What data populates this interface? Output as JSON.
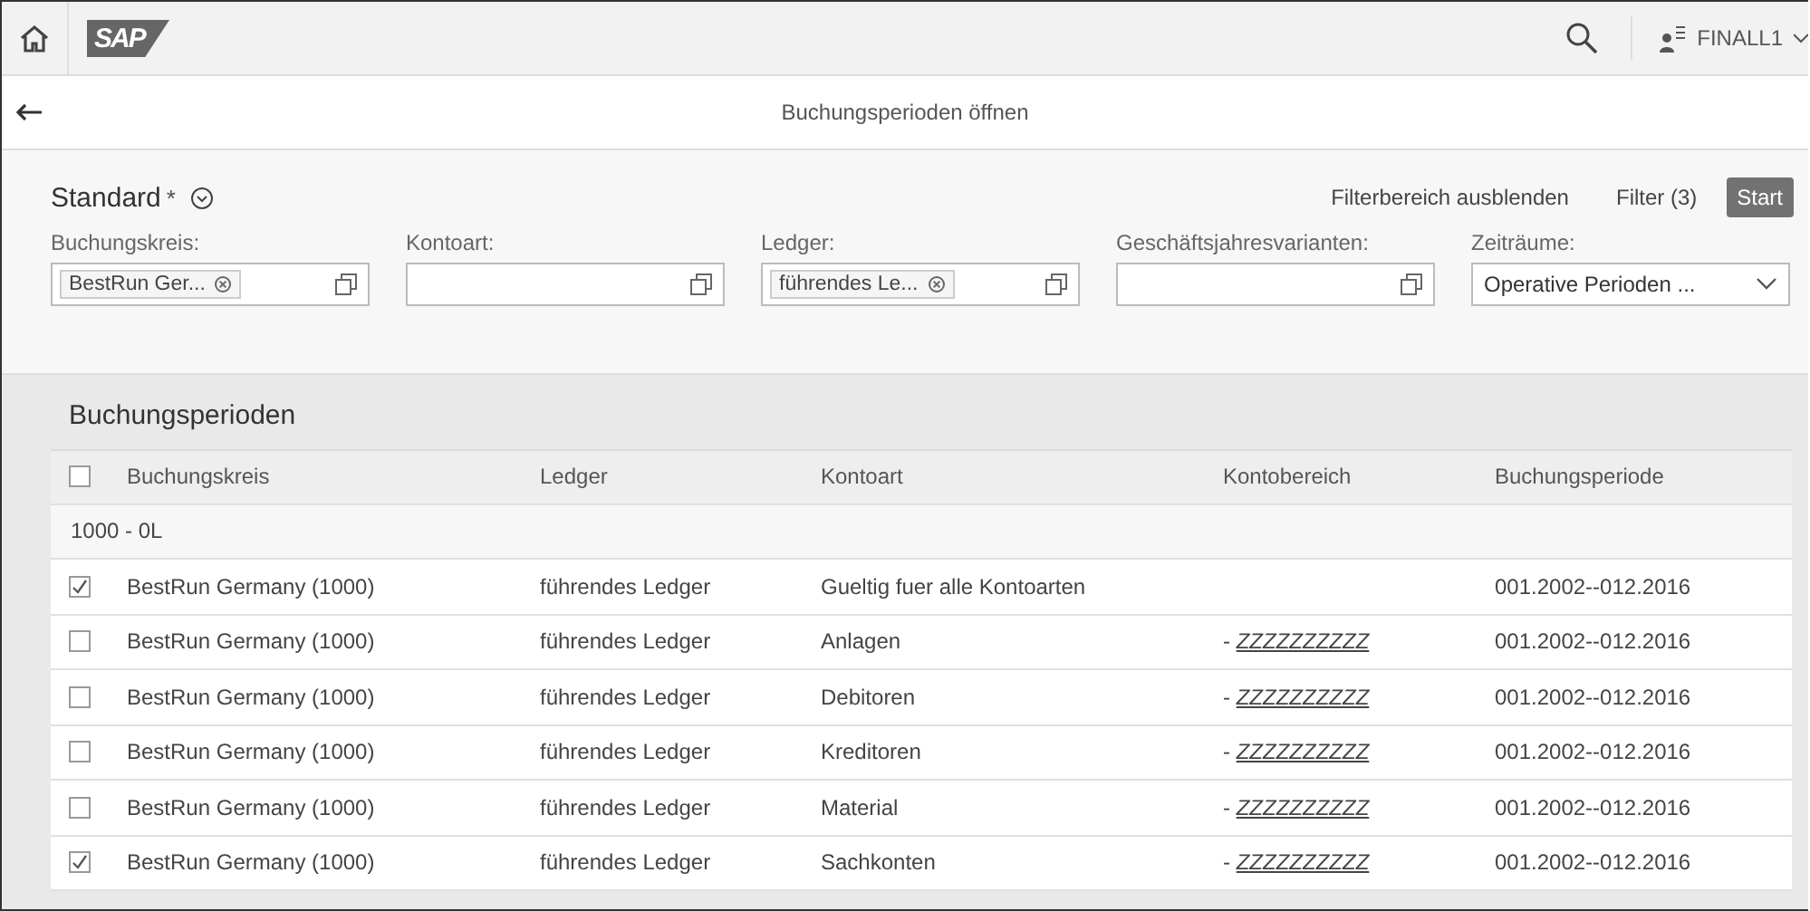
{
  "shell": {
    "logo": "SAP",
    "user": "FINALL1"
  },
  "page": {
    "title": "Buchungsperioden öffnen"
  },
  "filter_bar": {
    "variant": "Standard",
    "variant_modified": "*",
    "hide_filters": "Filterbereich ausblenden",
    "filters": "Filter (3)",
    "start": "Start",
    "fields": [
      {
        "kind": "tokens",
        "label": "Buchungskreis:",
        "tokens": [
          "BestRun Ger..."
        ]
      },
      {
        "kind": "input",
        "label": "Kontoart:"
      },
      {
        "kind": "tokens",
        "label": "Ledger:",
        "tokens": [
          "führendes Le..."
        ]
      },
      {
        "kind": "input",
        "label": "Geschäftsjahresvarianten:"
      },
      {
        "kind": "select",
        "label": "Zeiträume:",
        "value": "Operative Perioden ..."
      }
    ]
  },
  "table": {
    "title": "Buchungsperioden",
    "select_all": {
      "checked": false
    },
    "columns": [
      "Buchungskreis",
      "Ledger",
      "Kontoart",
      "Kontobereich",
      "Buchungsperiode"
    ],
    "groups": [
      {
        "label": "1000 - 0L",
        "rows": [
          {
            "checked": true,
            "company": "BestRun Germany (1000)",
            "ledger": "führendes Ledger",
            "account_type": "Gueltig fuer alle Kontoarten",
            "period": "001.2002--012.2016"
          },
          {
            "checked": false,
            "company": "BestRun Germany (1000)",
            "ledger": "führendes Ledger",
            "account_type": "Anlagen",
            "range_prefix": "-",
            "range_link": "ZZZZZZZZZZ",
            "period": "001.2002--012.2016"
          },
          {
            "checked": false,
            "company": "BestRun Germany (1000)",
            "ledger": "führendes Ledger",
            "account_type": "Debitoren",
            "range_prefix": "-",
            "range_link": "ZZZZZZZZZZ",
            "period": "001.2002--012.2016"
          },
          {
            "checked": false,
            "company": "BestRun Germany (1000)",
            "ledger": "führendes Ledger",
            "account_type": "Kreditoren",
            "range_prefix": "-",
            "range_link": "ZZZZZZZZZZ",
            "period": "001.2002--012.2016"
          },
          {
            "checked": false,
            "company": "BestRun Germany (1000)",
            "ledger": "führendes Ledger",
            "account_type": "Material",
            "range_prefix": "-",
            "range_link": "ZZZZZZZZZZ",
            "period": "001.2002--012.2016"
          },
          {
            "checked": true,
            "company": "BestRun Germany (1000)",
            "ledger": "führendes Ledger",
            "account_type": "Sachkonten",
            "range_prefix": "-",
            "range_link": "ZZZZZZZZZZ",
            "period": "001.2002--012.2016"
          }
        ]
      }
    ]
  }
}
